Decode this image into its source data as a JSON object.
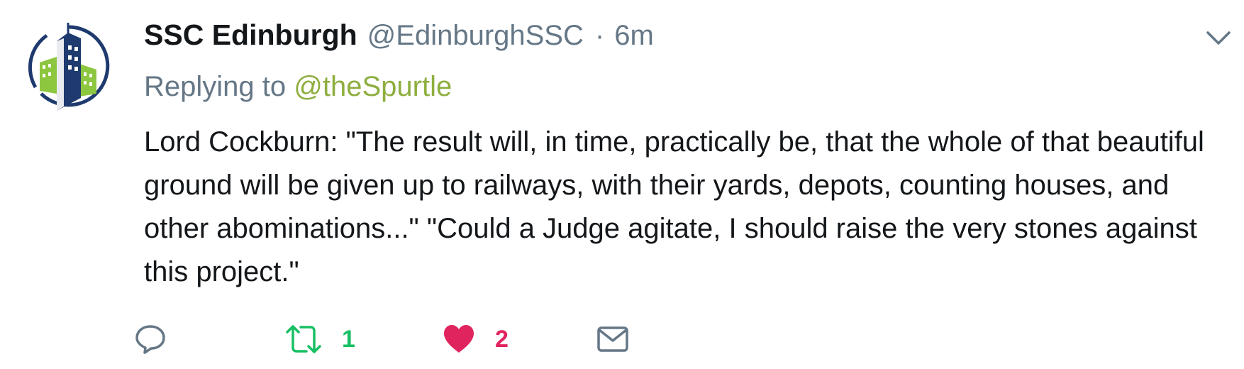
{
  "tweet": {
    "display_name": "SSC Edinburgh",
    "handle": "@EdinburghSSC",
    "separator": "·",
    "time": "6m",
    "replying_prefix": "Replying to",
    "replying_to": "@theSpurtle",
    "text": "Lord Cockburn: \"The result will, in time, practically be, that the whole of that beautiful ground will be given up to railways, with their yards, depots, counting houses, and other abominations...\" \"Could a Judge agitate, I should raise the very stones against this project.\""
  },
  "actions": {
    "reply": {
      "icon": "reply-icon"
    },
    "retweet": {
      "icon": "retweet-icon",
      "count": "1"
    },
    "like": {
      "icon": "heart-icon",
      "count": "2"
    },
    "message": {
      "icon": "envelope-icon"
    }
  },
  "colors": {
    "text": "#14171a",
    "secondary": "#657786",
    "link": "#8eae3e",
    "retweet": "#17bf63",
    "like": "#e0245e",
    "avatar_navy": "#1e3a6e",
    "avatar_green": "#8dc63f"
  }
}
